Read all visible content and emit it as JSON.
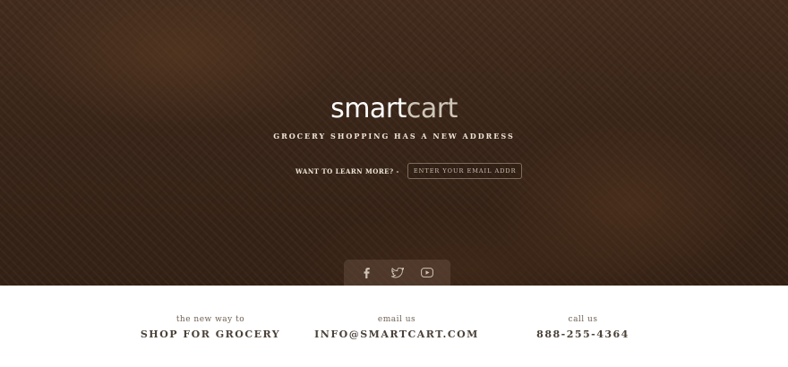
{
  "brand": {
    "name_part1": "smart",
    "name_part2": "cart"
  },
  "hero": {
    "tagline": "GROCERY SHOPPING HAS A NEW ADDRESS",
    "signup_label": "WANT TO LEARN MORE? -",
    "email_placeholder": "ENTER YOUR EMAIL ADDRESS"
  },
  "social": {
    "icons": [
      "facebook-icon",
      "twitter-icon",
      "youtube-icon"
    ]
  },
  "footer": {
    "col1": {
      "small": "the new way to",
      "big": "SHOP FOR GROCERY"
    },
    "col2": {
      "small": "email us",
      "big": "INFO@SMARTCART.COM"
    },
    "col3": {
      "small": "call us",
      "big": "888-255-4364"
    }
  },
  "colors": {
    "hero_bg": "#3f2a1d",
    "footer_bg": "#ffffff",
    "text_dark": "#4a4137"
  }
}
